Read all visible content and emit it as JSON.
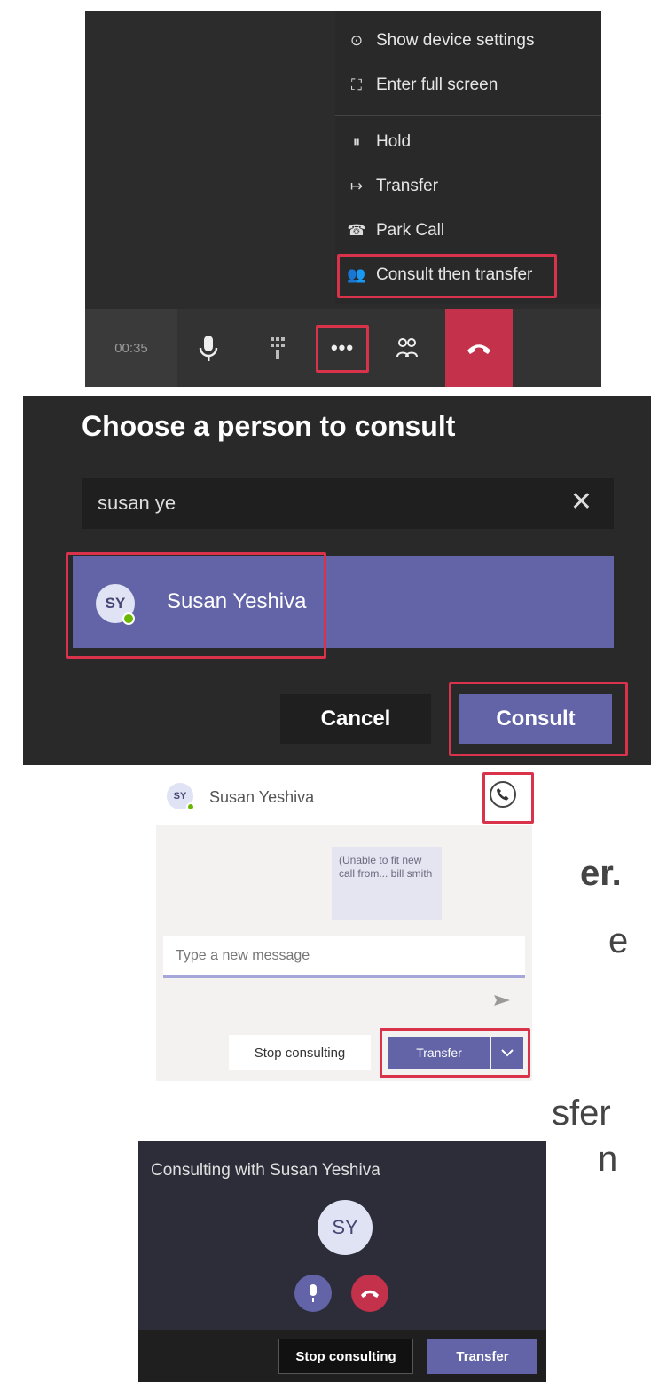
{
  "fragments": {
    "f1": ">",
    "f2": "e",
    "f3": "er.",
    "f4": "e",
    "f5": "sfer",
    "f6": "n"
  },
  "call_menu": {
    "items": [
      {
        "icon": "⊙",
        "label": "Show device settings"
      },
      {
        "icon": "⛶",
        "label": "Enter full screen"
      },
      {
        "icon": "⏸",
        "label": "Hold"
      },
      {
        "icon": "↦",
        "label": "Transfer"
      },
      {
        "icon": "☎",
        "label": "Park Call"
      },
      {
        "icon": "👥",
        "label": "Consult then transfer"
      }
    ]
  },
  "call_bar": {
    "timer": "00:35",
    "more_label": "•••"
  },
  "consult_dialog": {
    "title": "Choose a person to consult",
    "search_value": "susan ye",
    "clear_label": "✕",
    "result": {
      "initials": "SY",
      "name": "Susan Yeshiva"
    },
    "cancel_label": "Cancel",
    "consult_label": "Consult"
  },
  "chat_panel": {
    "initials": "SY",
    "name": "Susan Yeshiva",
    "message": "(Unable to fit new call from... bill smith",
    "compose_placeholder": "Type a new message",
    "stop_label": "Stop consulting",
    "transfer_label": "Transfer"
  },
  "consult_panel": {
    "title": "Consulting with Susan Yeshiva",
    "initials": "SY",
    "stop_label": "Stop consulting",
    "transfer_label": "Transfer"
  },
  "colors": {
    "accent": "#6264a7",
    "highlight": "#d8334a",
    "hangup": "#c4314b",
    "dark_panel": "#292929"
  }
}
